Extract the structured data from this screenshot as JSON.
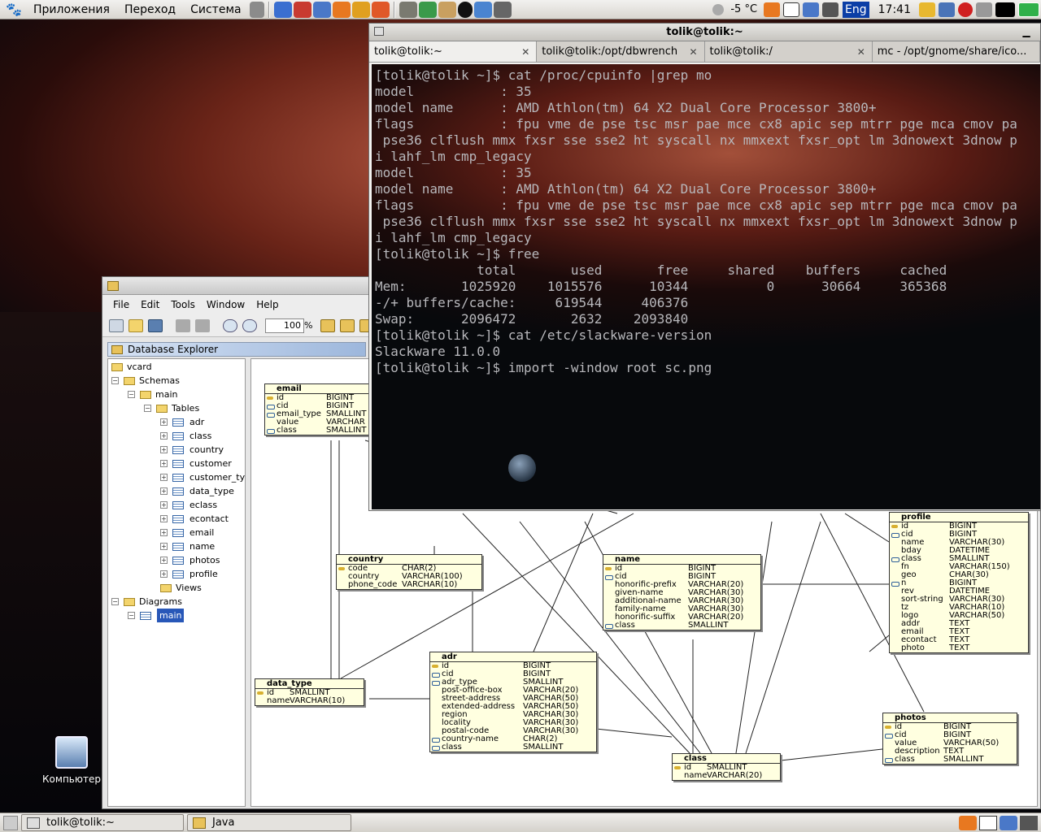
{
  "top_panel": {
    "menus": [
      "Приложения",
      "Переход",
      "Система"
    ],
    "temperature": "-5 °C",
    "language": "Eng",
    "clock": "17:41"
  },
  "desktop": {
    "icon_label": "Компьютер"
  },
  "taskbar": {
    "items": [
      "tolik@tolik:~",
      "Java"
    ]
  },
  "terminal": {
    "title": "tolik@tolik:~",
    "tabs": [
      "tolik@tolik:~",
      "tolik@tolik:/opt/dbwrench",
      "tolik@tolik:/",
      "mc - /opt/gnome/share/ico..."
    ],
    "lines": [
      "[tolik@tolik ~]$ cat /proc/cpuinfo |grep mo",
      "model           : 35",
      "model name      : AMD Athlon(tm) 64 X2 Dual Core Processor 3800+",
      "flags           : fpu vme de pse tsc msr pae mce cx8 apic sep mtrr pge mca cmov pa",
      " pse36 clflush mmx fxsr sse sse2 ht syscall nx mmxext fxsr_opt lm 3dnowext 3dnow p",
      "i lahf_lm cmp_legacy",
      "model           : 35",
      "model name      : AMD Athlon(tm) 64 X2 Dual Core Processor 3800+",
      "flags           : fpu vme de pse tsc msr pae mce cx8 apic sep mtrr pge mca cmov pa",
      " pse36 clflush mmx fxsr sse sse2 ht syscall nx mmxext fxsr_opt lm 3dnowext 3dnow p",
      "i lahf_lm cmp_legacy",
      "[tolik@tolik ~]$ free",
      "             total       used       free     shared    buffers     cached",
      "Mem:       1025920    1015576      10344          0      30664     365368",
      "-/+ buffers/cache:     619544     406376",
      "Swap:      2096472       2632    2093840",
      "[tolik@tolik ~]$ cat /etc/slackware-version",
      "Slackware 11.0.0",
      "[tolik@tolik ~]$ import -window root sc.png"
    ]
  },
  "java_app": {
    "menus": [
      "File",
      "Edit",
      "Tools",
      "Window",
      "Help"
    ],
    "zoom_value": "100",
    "zoom_unit": "%",
    "explorer_title": "Database Explorer",
    "tree": {
      "root": "vcard",
      "schemas": "Schemas",
      "schema": "main",
      "tables_folder": "Tables",
      "tables": [
        "adr",
        "class",
        "country",
        "customer",
        "customer_ty",
        "data_type",
        "eclass",
        "econtact",
        "email",
        "name",
        "photos",
        "profile"
      ],
      "views": "Views",
      "diagrams": "Diagrams",
      "diagram": "main"
    },
    "entities": [
      {
        "name": "email",
        "columns": [
          [
            "id",
            "BIGINT",
            "pk"
          ],
          [
            "cid",
            "BIGINT",
            "fk"
          ],
          [
            "email_type",
            "SMALLINT",
            "fk"
          ],
          [
            "value",
            "VARCHAR",
            ""
          ],
          [
            "class",
            "SMALLINT",
            "fk"
          ]
        ]
      },
      {
        "name": "country",
        "columns": [
          [
            "code",
            "CHAR(2)",
            "pk"
          ],
          [
            "country",
            "VARCHAR(100)",
            ""
          ],
          [
            "phone_code",
            "VARCHAR(10)",
            ""
          ]
        ]
      },
      {
        "name": "name",
        "columns": [
          [
            "id",
            "BIGINT",
            "pk"
          ],
          [
            "cid",
            "BIGINT",
            "fk"
          ],
          [
            "honorific-prefix",
            "VARCHAR(20)",
            ""
          ],
          [
            "given-name",
            "VARCHAR(30)",
            ""
          ],
          [
            "additional-name",
            "VARCHAR(30)",
            ""
          ],
          [
            "family-name",
            "VARCHAR(30)",
            ""
          ],
          [
            "honorific-suffix",
            "VARCHAR(20)",
            ""
          ],
          [
            "class",
            "SMALLINT",
            "fk"
          ]
        ]
      },
      {
        "name": "profile",
        "columns": [
          [
            "id",
            "BIGINT",
            "pk"
          ],
          [
            "cid",
            "BIGINT",
            "fk"
          ],
          [
            "name",
            "VARCHAR(30)",
            ""
          ],
          [
            "bday",
            "DATETIME",
            ""
          ],
          [
            "class",
            "SMALLINT",
            "fk"
          ],
          [
            "fn",
            "VARCHAR(150)",
            ""
          ],
          [
            "geo",
            "CHAR(30)",
            ""
          ],
          [
            "n",
            "BIGINT",
            "fk"
          ],
          [
            "rev",
            "DATETIME",
            ""
          ],
          [
            "sort-string",
            "VARCHAR(30)",
            ""
          ],
          [
            "tz",
            "VARCHAR(10)",
            ""
          ],
          [
            "logo",
            "VARCHAR(50)",
            ""
          ],
          [
            "addr",
            "TEXT",
            ""
          ],
          [
            "email",
            "TEXT",
            ""
          ],
          [
            "econtact",
            "TEXT",
            ""
          ],
          [
            "photo",
            "TEXT",
            ""
          ]
        ]
      },
      {
        "name": "data_type",
        "columns": [
          [
            "id",
            "SMALLINT",
            "pk"
          ],
          [
            "name",
            "VARCHAR(10)",
            ""
          ]
        ]
      },
      {
        "name": "adr",
        "columns": [
          [
            "id",
            "BIGINT",
            "pk"
          ],
          [
            "cid",
            "BIGINT",
            "fk"
          ],
          [
            "adr_type",
            "SMALLINT",
            "fk"
          ],
          [
            "post-office-box",
            "VARCHAR(20)",
            ""
          ],
          [
            "street-address",
            "VARCHAR(50)",
            ""
          ],
          [
            "extended-address",
            "VARCHAR(50)",
            ""
          ],
          [
            "region",
            "VARCHAR(30)",
            ""
          ],
          [
            "locality",
            "VARCHAR(30)",
            ""
          ],
          [
            "postal-code",
            "VARCHAR(30)",
            ""
          ],
          [
            "country-name",
            "CHAR(2)",
            "fk"
          ],
          [
            "class",
            "SMALLINT",
            "fk"
          ]
        ]
      },
      {
        "name": "photos",
        "columns": [
          [
            "id",
            "BIGINT",
            "pk"
          ],
          [
            "cid",
            "BIGINT",
            "fk"
          ],
          [
            "value",
            "VARCHAR(50)",
            ""
          ],
          [
            "description",
            "TEXT",
            ""
          ],
          [
            "class",
            "SMALLINT",
            "fk"
          ]
        ]
      },
      {
        "name": "class",
        "columns": [
          [
            "id",
            "SMALLINT",
            "pk"
          ],
          [
            "name",
            "VARCHAR(20)",
            ""
          ]
        ]
      }
    ]
  }
}
